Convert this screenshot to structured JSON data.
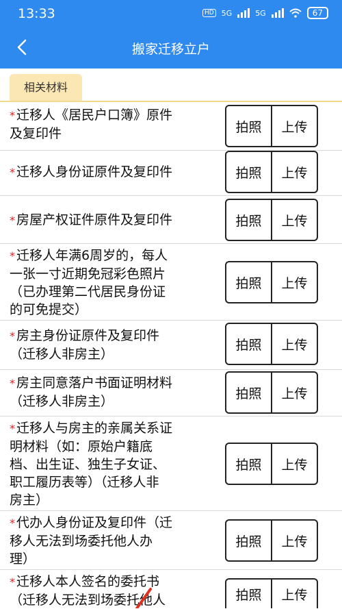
{
  "status": {
    "time": "13:33",
    "hd": "HD",
    "net1": "5G",
    "net2": "5G",
    "battery": "67"
  },
  "header": {
    "title": "搬家迁移立户"
  },
  "section": {
    "label": "相关材料"
  },
  "buttons": {
    "photo": "拍照",
    "upload": "上传"
  },
  "required_mark": "*",
  "items": [
    {
      "lines": [
        "迁移人《居民户口簿》原件",
        "及复印件"
      ]
    },
    {
      "lines": [
        "迁移人身份证原件及复印件"
      ]
    },
    {
      "lines": [
        "房屋产权证件原件及复印件"
      ]
    },
    {
      "lines": [
        "迁移人年满6周岁的，每人",
        "一张一寸近期免冠彩色照片",
        "（已办理第二代居民身份证",
        "的可免提交）"
      ]
    },
    {
      "lines": [
        "房主身份证原件及复印件",
        "（迁移人非房主）"
      ]
    },
    {
      "lines": [
        "房主同意落户书面证明材料",
        "（迁移人非房主）"
      ]
    },
    {
      "lines": [
        "迁移人与房主的亲属关系证",
        "明材料（如：原始户籍底",
        "档、出生证、独生子女证、",
        "职工履历表等）（迁移人非",
        "房主）"
      ]
    },
    {
      "lines": [
        "代办人身份证及复印件（迁",
        "移人无法到场委托他人办",
        "理）"
      ]
    },
    {
      "lines": [
        "迁移人本人签名的委托书",
        "（迁移人无法到场委托他人"
      ]
    }
  ]
}
